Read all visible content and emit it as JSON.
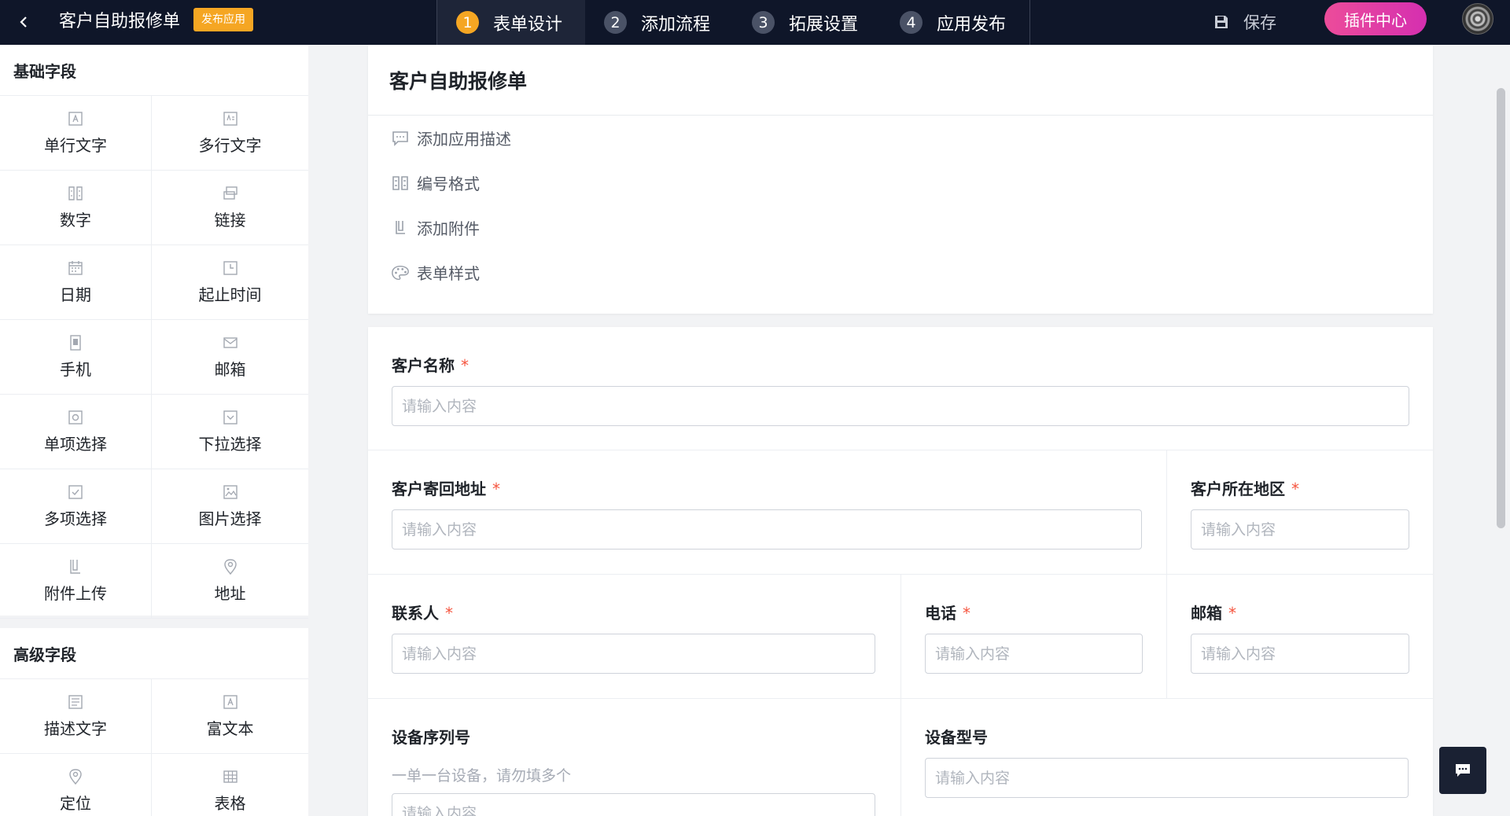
{
  "topbar": {
    "title": "客户自助报修单",
    "badge": "发布应用",
    "steps": [
      {
        "num": "1",
        "label": "表单设计",
        "active": true
      },
      {
        "num": "2",
        "label": "添加流程",
        "active": false
      },
      {
        "num": "3",
        "label": "拓展设置",
        "active": false
      },
      {
        "num": "4",
        "label": "应用发布",
        "active": false
      }
    ],
    "save_label": "保存",
    "plugin_label": "插件中心",
    "colors": {
      "bar": "#0f1629",
      "badge": "#f5a623",
      "plugin": "#ec4c9a"
    }
  },
  "sidebar": {
    "basic_title": "基础字段",
    "basic_fields": [
      {
        "label": "单行文字",
        "icon": "text-icon"
      },
      {
        "label": "多行文字",
        "icon": "multiline-text-icon"
      },
      {
        "label": "数字",
        "icon": "number-icon"
      },
      {
        "label": "链接",
        "icon": "link-icon"
      },
      {
        "label": "日期",
        "icon": "calendar-icon"
      },
      {
        "label": "起止时间",
        "icon": "clock-icon"
      },
      {
        "label": "手机",
        "icon": "phone-icon"
      },
      {
        "label": "邮箱",
        "icon": "mail-icon"
      },
      {
        "label": "单项选择",
        "icon": "radio-icon"
      },
      {
        "label": "下拉选择",
        "icon": "dropdown-icon"
      },
      {
        "label": "多项选择",
        "icon": "checkbox-icon"
      },
      {
        "label": "图片选择",
        "icon": "image-icon"
      },
      {
        "label": "附件上传",
        "icon": "attachment-icon"
      },
      {
        "label": "地址",
        "icon": "location-pin-icon"
      }
    ],
    "advanced_title": "高级字段",
    "advanced_fields": [
      {
        "label": "描述文字",
        "icon": "description-icon"
      },
      {
        "label": "富文本",
        "icon": "rich-text-icon"
      },
      {
        "label": "定位",
        "icon": "location-pin-icon"
      },
      {
        "label": "表格",
        "icon": "table-icon"
      }
    ]
  },
  "form_header": {
    "title": "客户自助报修单",
    "options": [
      {
        "label": "添加应用描述",
        "icon": "comment-icon"
      },
      {
        "label": "编号格式",
        "icon": "number-icon"
      },
      {
        "label": "添加附件",
        "icon": "attachment-icon"
      },
      {
        "label": "表单样式",
        "icon": "palette-icon"
      }
    ]
  },
  "form": {
    "placeholder": "请输入内容",
    "required_mark": "*",
    "fields": {
      "customer_name": "客户名称",
      "return_address": "客户寄回地址",
      "region": "客户所在地区",
      "contact": "联系人",
      "phone": "电话",
      "email": "邮箱",
      "serial": "设备序列号",
      "serial_hint": "一单一台设备，请勿填多个",
      "model": "设备型号"
    }
  }
}
